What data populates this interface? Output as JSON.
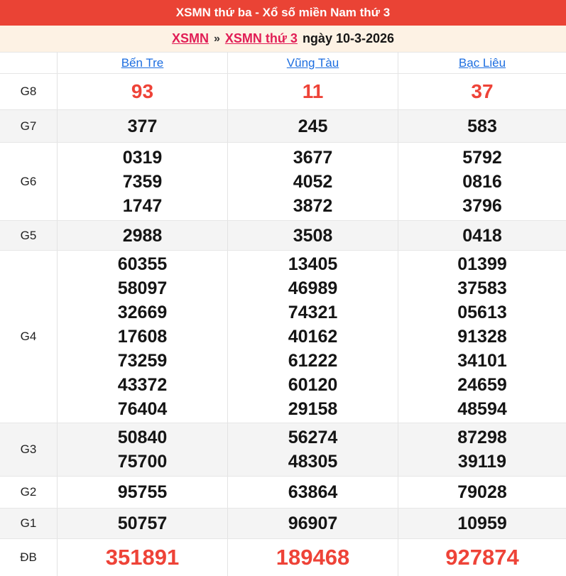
{
  "header": {
    "title": "XSMN thứ ba - Xổ số miền Nam thứ 3"
  },
  "breadcrumb": {
    "links": [
      {
        "label": "XSMN"
      },
      {
        "label": "XSMN thứ 3"
      }
    ],
    "separator": "»",
    "date_text": "ngày 10-3-2026"
  },
  "table": {
    "columns": [
      "Bến Tre",
      "Vũng Tàu",
      "Bạc Liêu"
    ],
    "rows": [
      {
        "label": "G8",
        "highlight": true,
        "big": false,
        "cells": [
          [
            "93"
          ],
          [
            "11"
          ],
          [
            "37"
          ]
        ]
      },
      {
        "label": "G7",
        "highlight": false,
        "big": false,
        "cells": [
          [
            "377"
          ],
          [
            "245"
          ],
          [
            "583"
          ]
        ]
      },
      {
        "label": "G6",
        "highlight": false,
        "big": false,
        "cells": [
          [
            "0319",
            "7359",
            "1747"
          ],
          [
            "3677",
            "4052",
            "3872"
          ],
          [
            "5792",
            "0816",
            "3796"
          ]
        ]
      },
      {
        "label": "G5",
        "highlight": false,
        "big": false,
        "cells": [
          [
            "2988"
          ],
          [
            "3508"
          ],
          [
            "0418"
          ]
        ]
      },
      {
        "label": "G4",
        "highlight": false,
        "big": false,
        "cells": [
          [
            "60355",
            "58097",
            "32669",
            "17608",
            "73259",
            "43372",
            "76404"
          ],
          [
            "13405",
            "46989",
            "74321",
            "40162",
            "61222",
            "60120",
            "29158"
          ],
          [
            "01399",
            "37583",
            "05613",
            "91328",
            "34101",
            "24659",
            "48594"
          ]
        ]
      },
      {
        "label": "G3",
        "highlight": false,
        "big": false,
        "cells": [
          [
            "50840",
            "75700"
          ],
          [
            "56274",
            "48305"
          ],
          [
            "87298",
            "39119"
          ]
        ]
      },
      {
        "label": "G2",
        "highlight": false,
        "big": false,
        "cells": [
          [
            "95755"
          ],
          [
            "63864"
          ],
          [
            "79028"
          ]
        ]
      },
      {
        "label": "G1",
        "highlight": false,
        "big": false,
        "cells": [
          [
            "50757"
          ],
          [
            "96907"
          ],
          [
            "10959"
          ]
        ]
      },
      {
        "label": "ĐB",
        "highlight": true,
        "big": true,
        "cells": [
          [
            "351891"
          ],
          [
            "189468"
          ],
          [
            "927874"
          ]
        ]
      }
    ]
  },
  "colors": {
    "accent_red": "#ea4335",
    "number_red": "#ee4338",
    "link_red": "#e11d55",
    "link_blue": "#1d6ee0",
    "row_alt_gray": "#f4f4f4",
    "breadcrumb_bg": "#fdf2e4"
  }
}
